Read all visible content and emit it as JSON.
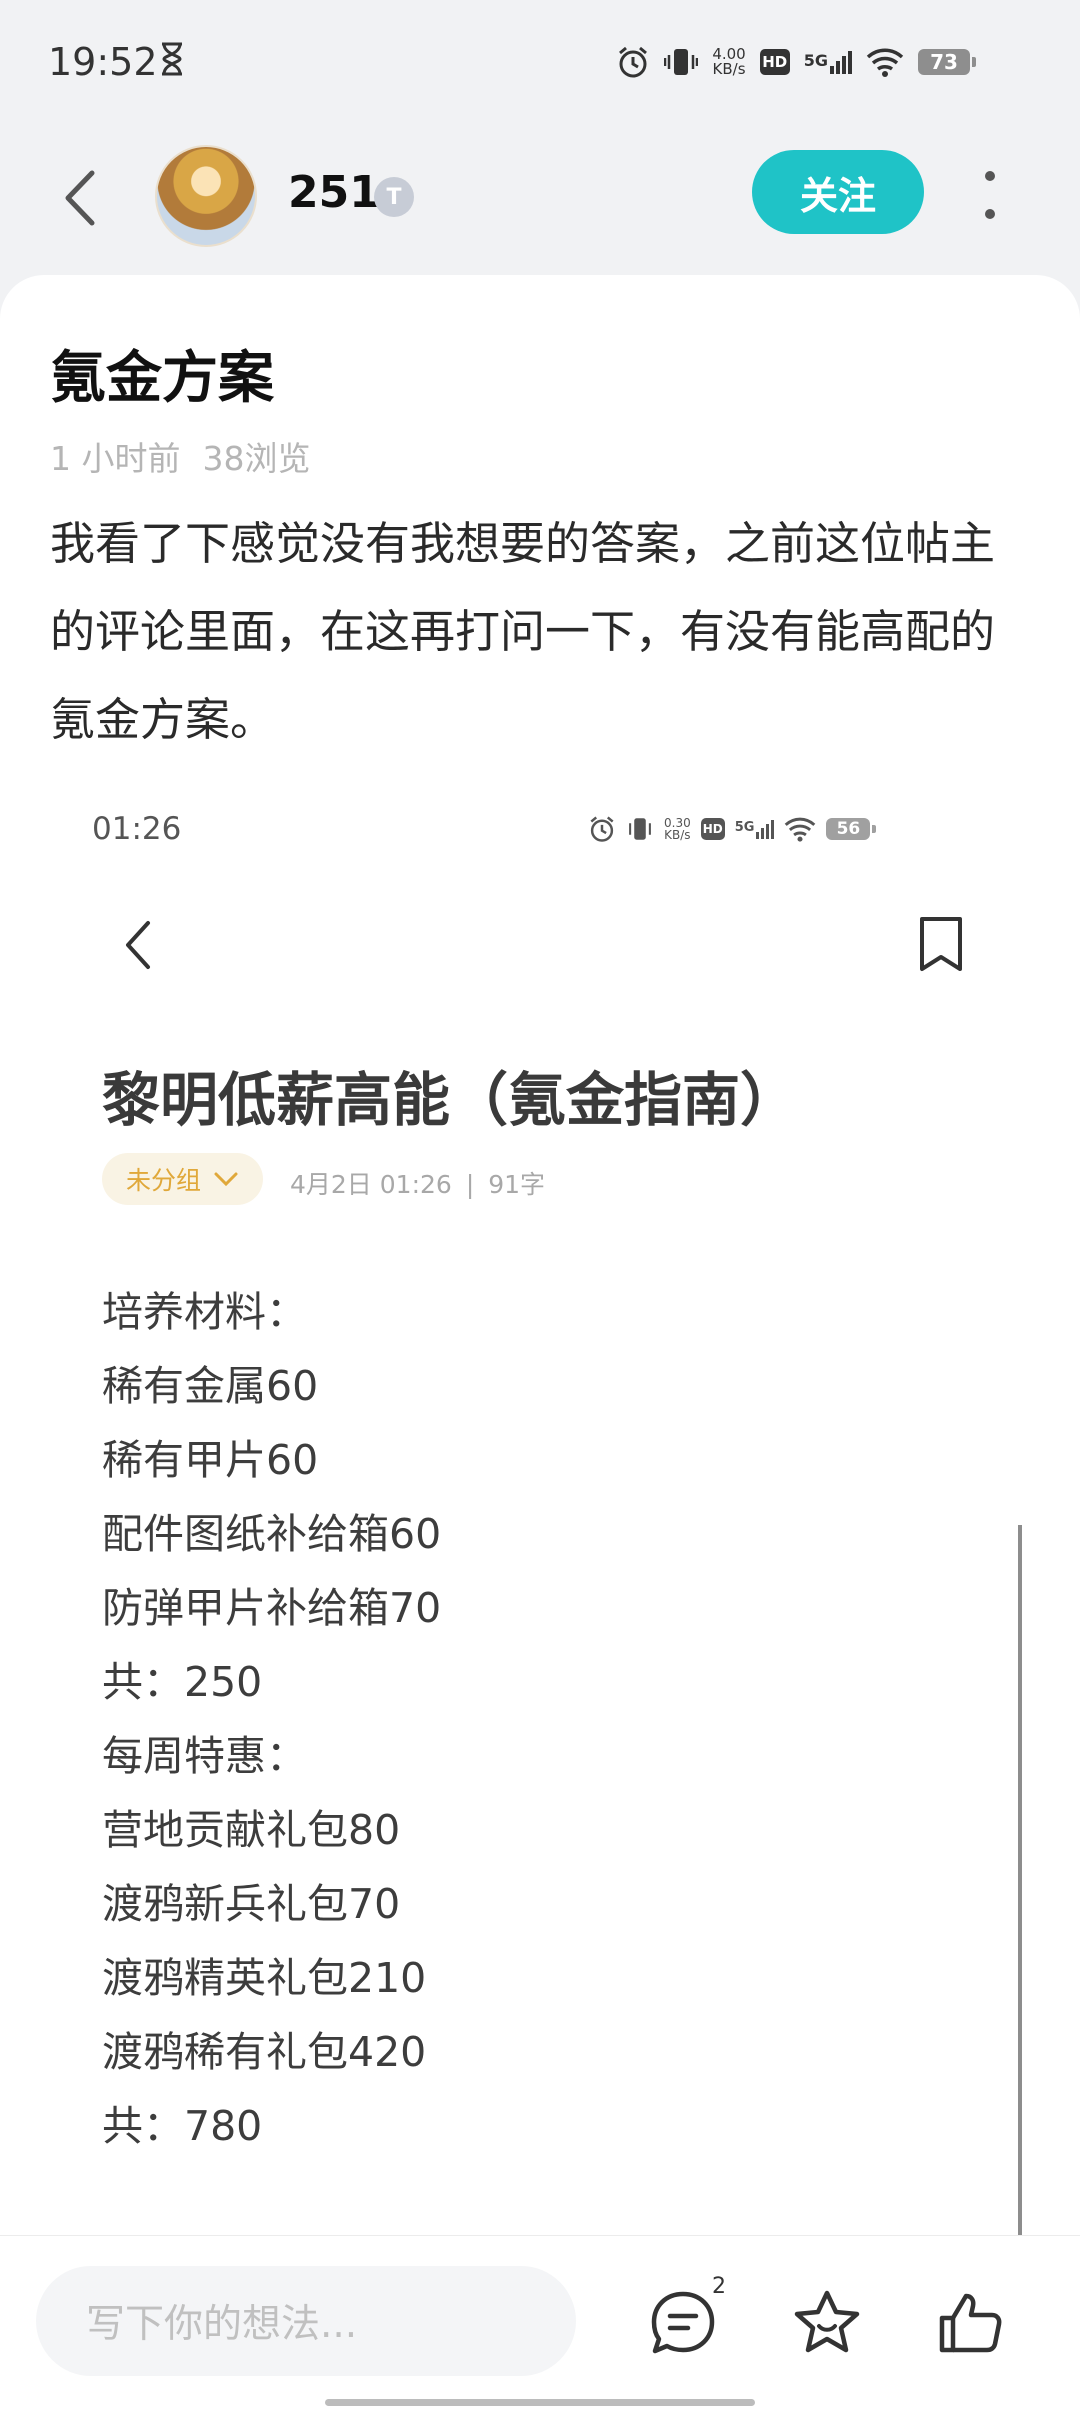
{
  "status_bar": {
    "time": "19:52",
    "net_speed_value": "4.00",
    "net_speed_unit": "KB/s",
    "hd": "HD",
    "signal": "5G",
    "battery": "73"
  },
  "header": {
    "username": "251",
    "level_badge": "T",
    "follow_label": "关注"
  },
  "post": {
    "title": "氪金方案",
    "time_ago": "1 小时前",
    "views": "38浏览",
    "body": "我看了下感觉没有我想要的答案，之前这位帖主的评论里面，在这再打问一下，有没有能高配的氪金方案。"
  },
  "embedded": {
    "time": "01:26",
    "net_speed_value": "0.30",
    "net_speed_unit": "KB/s",
    "hd": "HD",
    "signal": "5G",
    "battery": "56",
    "title": "黎明低薪高能（氪金指南）",
    "tag": "未分组",
    "date": "4月2日 01:26",
    "separator": "|",
    "word_count": "91字",
    "lines": [
      "培养材料：",
      "稀有金属60",
      "稀有甲片60",
      "配件图纸补给箱60",
      "防弹甲片补给箱70",
      "共：250",
      "每周特惠：",
      "营地贡献礼包80",
      "渡鸦新兵礼包70",
      "渡鸦精英礼包210",
      "渡鸦稀有礼包420",
      "共：780"
    ]
  },
  "bottom_bar": {
    "comment_placeholder": "写下你的想法...",
    "comment_count": "2"
  },
  "colors": {
    "accent": "#1fc3c7",
    "tag_text": "#e0a83a",
    "tag_bg": "#f9f3e4"
  },
  "icons": [
    "hourglass-icon",
    "alarm-icon",
    "vibrate-icon",
    "wifi-icon",
    "back-arrow-icon",
    "more-icon",
    "bookmark-icon",
    "comment-icon",
    "favorite-icon",
    "like-icon",
    "chevron-down-icon"
  ]
}
